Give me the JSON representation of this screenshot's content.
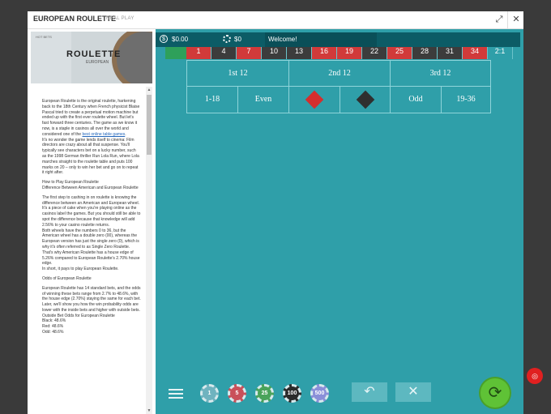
{
  "window": {
    "title": "EUROPEAN ROULETTE",
    "mode_label": "REAL PLAY",
    "expand_icon": "expand-icon",
    "close_icon": "close-icon"
  },
  "thumbnail": {
    "logo_text": "ROULETTE",
    "logo_sub": "EUROPEAN",
    "mini_label": "HOT BETS"
  },
  "article": {
    "p1a": "European Roulette is the original roulette, harkening back to the 18th Century when French physicist Blaise Pascal tried to create a perpetual motion machine but ended up with the first ever roulette wheel. But let's fast forward three centuries. The game as we know it now, is a staple in casinos all over the world and considered one of the ",
    "p1_link": "best online table games",
    "p1b": ".",
    "p2": "It's no wonder the game lends itself to cinema: Film directors are crazy about all that suspense. You'll typically see characters bet on a lucky number, such as the 1998 German thriller Run Lola Run, where Lola marches straight to the roulette table and puts 100 marks on 20 – only to win her bet and go on to repeat it right after.",
    "h1": "How to Play European Roulette",
    "h1b": "Difference Between American and European Roulette",
    "p3": "The first step to cashing in on roulette is knowing the difference between an American and European wheel. It's a piece of cake when you're playing online as the casinos label the games. But you should still be able to spot the difference because that knowledge will add 2.56% to your casino roulette returns.",
    "p4": "Both wheels have the numbers 0 to 36, but the American wheel has a double zero (00), whereas the European version has just the single zero (0), which is why it's often referred to as Single Zero Roulette. That's why American Roulette has a house edge of 5.26% compared to European Roulette's 2.70% house edge.",
    "p5": "In short, it pays to play European Roulette.",
    "h2": "Odds of European Roulette",
    "p6": "European Roulette has 14 standard bets, and the odds of winning these bets range from 2.7% to 48.6%, with the house edge (2.70%) staying the same for each bet. Later, we'll show you how the win probability odds are lower with the inside bets and higher with outside bets.",
    "h3": "Outside Bet Odds for European Roulette",
    "odds": [
      "Black:   48.6%",
      "Red:     48.6%",
      "Odd:     48.6%"
    ]
  },
  "topbar": {
    "balance_icon": "dollar-coin-icon",
    "balance": "$0.00",
    "bet_icon": "chip-icon",
    "bet": "$0",
    "welcome": "Welcome!"
  },
  "table": {
    "top_numbers": [
      {
        "n": "1",
        "c": "red"
      },
      {
        "n": "4",
        "c": "black"
      },
      {
        "n": "7",
        "c": "red"
      },
      {
        "n": "10",
        "c": "black"
      },
      {
        "n": "13",
        "c": "black"
      },
      {
        "n": "16",
        "c": "red"
      },
      {
        "n": "19",
        "c": "red"
      },
      {
        "n": "22",
        "c": "black"
      },
      {
        "n": "25",
        "c": "red"
      },
      {
        "n": "28",
        "c": "black"
      },
      {
        "n": "31",
        "c": "black"
      },
      {
        "n": "34",
        "c": "red"
      },
      {
        "n": "2:1",
        "c": "col"
      }
    ],
    "dozens": [
      "1st 12",
      "2nd 12",
      "3rd 12"
    ],
    "outside": {
      "low": "1-18",
      "even": "Even",
      "odd": "Odd",
      "high": "19-36"
    },
    "colors": {
      "red": "#d42e2e",
      "black": "#2f2f2f",
      "felt": "#2f9fa9"
    }
  },
  "controls": {
    "menu_icon": "menu-icon",
    "chips": [
      {
        "label": "1",
        "color": "#6fb3bf"
      },
      {
        "label": "5",
        "color": "#c9505a"
      },
      {
        "label": "25",
        "color": "#4aa35b"
      },
      {
        "label": "100",
        "color": "#2b2b2b"
      },
      {
        "label": "500",
        "color": "#8a8fd8"
      }
    ],
    "undo_icon": "undo-icon",
    "clear_icon": "clear-icon",
    "spin_icon": "spin-icon"
  },
  "chat_icon": "chat-icon"
}
